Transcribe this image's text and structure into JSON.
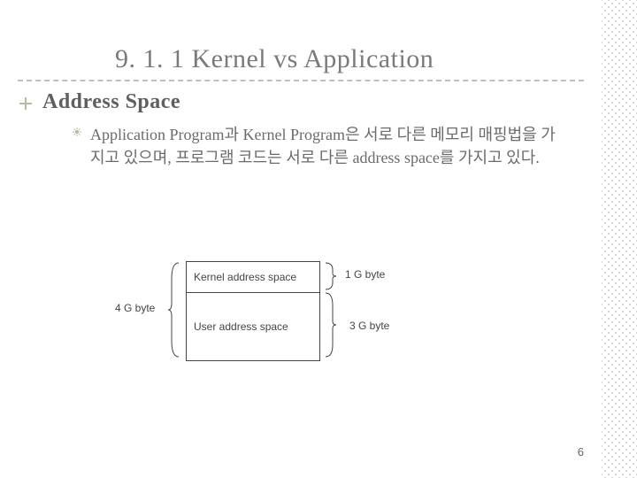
{
  "title": "9. 1. 1 Kernel vs Application",
  "subtitle": "Address Space",
  "body_text": "Application Program과 Kernel Program은 서로 다른 메모리 매핑법을 가지고 있으며, 프로그램 코드는 서로 다른 address space를 가지고 있다.",
  "diagram": {
    "kernel_cell": "Kernel address space",
    "user_cell": "User address space",
    "total_label": "4 G byte",
    "kernel_label": "1 G byte",
    "user_label": "3 G byte"
  },
  "page_number": "6"
}
